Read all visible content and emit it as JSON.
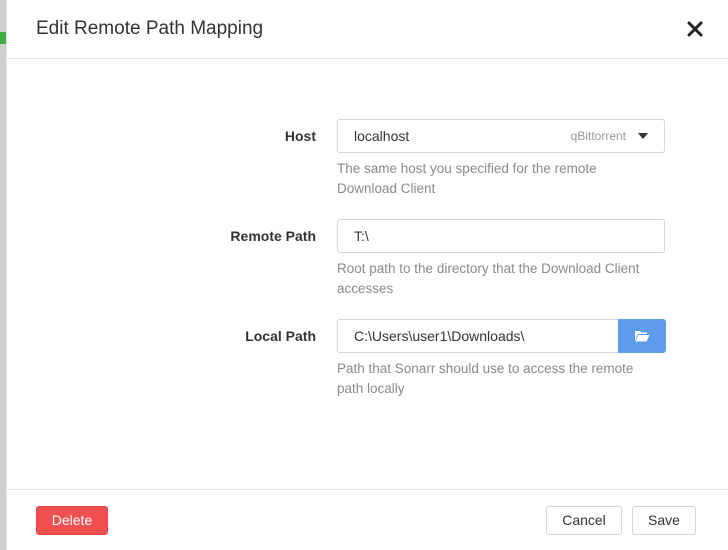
{
  "dialog": {
    "title": "Edit Remote Path Mapping",
    "close_symbol": "✕"
  },
  "fields": {
    "host": {
      "label": "Host",
      "value": "localhost",
      "client_hint": "qBittorrent",
      "help": "The same host you specified for the remote Download Client"
    },
    "remote_path": {
      "label": "Remote Path",
      "value": "T:\\",
      "help": "Root path to the directory that the Download Client accesses"
    },
    "local_path": {
      "label": "Local Path",
      "value": "C:\\Users\\user1\\Downloads\\",
      "help": "Path that Sonarr should use to access the remote path locally",
      "browse_icon": "folder-open-icon"
    }
  },
  "footer": {
    "delete_label": "Delete",
    "cancel_label": "Cancel",
    "save_label": "Save"
  },
  "colors": {
    "delete": "#f05050",
    "browse": "#5d9cec"
  }
}
